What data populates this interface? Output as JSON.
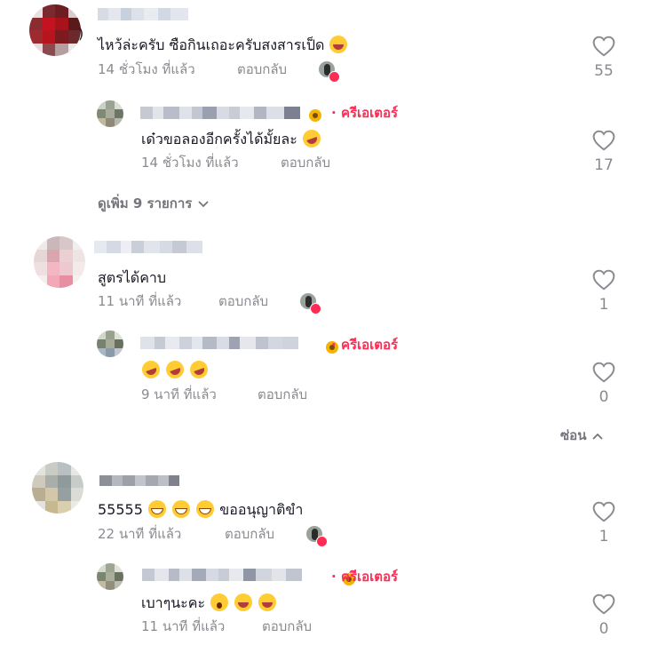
{
  "colors": {
    "creator": "#fe2c55",
    "muted": "#8a8b91",
    "text": "#161823"
  },
  "comments": [
    {
      "text": "ไหว้ล่ะครับ ซือกินเถอะครับสงสารเป็ด",
      "emojis": [
        "laughing-emoji"
      ],
      "time": "14 ชั่วโมง ที่แล้ว",
      "reply_label": "ตอบกลับ",
      "likes": "55",
      "creator_liked": true,
      "replies": [
        {
          "creator_badge": "ครีเอเตอร์",
          "badge_dot": "·",
          "text": "เด๋วขอลองอีกครั้งได้มั้ยละ",
          "emojis": [
            "rolling-laughing-emoji"
          ],
          "time": "14 ชั่วโมง ที่แล้ว",
          "reply_label": "ตอบกลับ",
          "likes": "17"
        }
      ],
      "view_more": "ดูเพิ่ม 9 รายการ"
    },
    {
      "text": "สูตรได้คาบ",
      "emojis": [],
      "time": "11 นาที ที่แล้ว",
      "reply_label": "ตอบกลับ",
      "likes": "1",
      "creator_liked": true,
      "replies": [
        {
          "creator_badge": "ครีเอเตอร์",
          "badge_dot": "·",
          "text": "",
          "emojis": [
            "rolling-laughing-emoji",
            "rolling-laughing-emoji",
            "rolling-laughing-emoji"
          ],
          "time": "9 นาที ที่แล้ว",
          "reply_label": "ตอบกลับ",
          "likes": "0"
        }
      ],
      "hide_label": "ซ่อน"
    },
    {
      "text": "55555",
      "text_after": "ขออนุญาติขำ",
      "emojis": [
        "grinning-emoji",
        "grinning-emoji",
        "grinning-emoji"
      ],
      "time": "22 นาที ที่แล้ว",
      "reply_label": "ตอบกลับ",
      "likes": "1",
      "creator_liked": true,
      "replies": [
        {
          "creator_badge": "ครีเอเตอร์",
          "badge_dot": "·",
          "text": "เบาๆนะคะ",
          "emojis": [
            "shocked-emoji",
            "laughing-emoji",
            "laughing-emoji"
          ],
          "time": "11 นาที ที่แล้ว",
          "reply_label": "ตอบกลับ",
          "likes": "0"
        }
      ]
    }
  ]
}
